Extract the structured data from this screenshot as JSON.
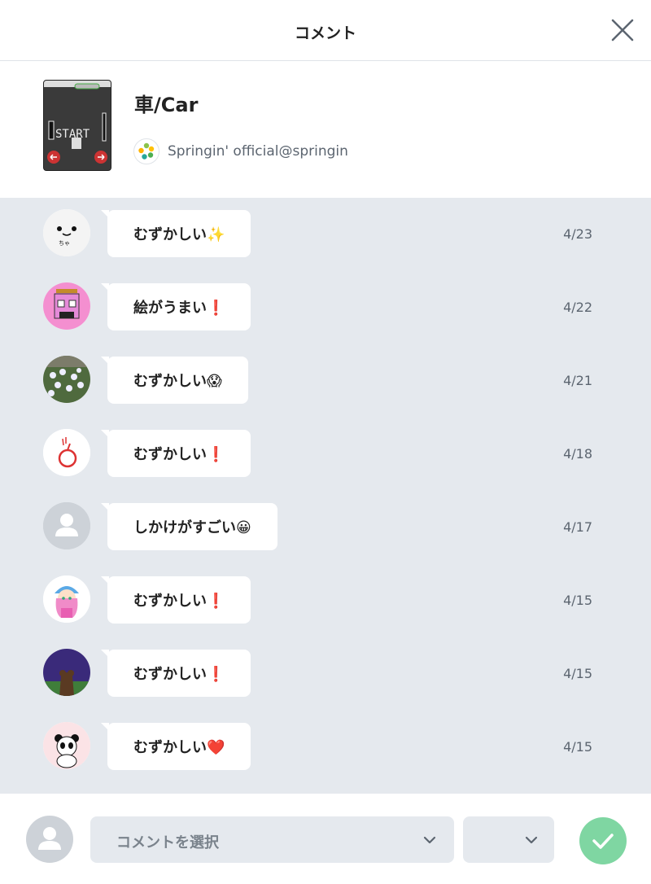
{
  "header": {
    "title": "コメント"
  },
  "work": {
    "title": "車/Car",
    "author": "Springin' official@springin",
    "thumb_text": "START"
  },
  "comments": [
    {
      "text": "むずかしい✨",
      "date": "4/23",
      "avatar": "face-white"
    },
    {
      "text": "絵がうまい❗",
      "date": "4/22",
      "avatar": "pink-robot"
    },
    {
      "text": "むずかしい😱",
      "date": "4/21",
      "avatar": "flowers-photo"
    },
    {
      "text": "むずかしい❗",
      "date": "4/18",
      "avatar": "red-apple"
    },
    {
      "text": "しかけがすごい😀",
      "date": "4/17",
      "avatar": "default-user"
    },
    {
      "text": "むずかしい❗",
      "date": "4/15",
      "avatar": "girl-blue-hat"
    },
    {
      "text": "むずかしい❗",
      "date": "4/15",
      "avatar": "night-scene"
    },
    {
      "text": "むずかしい❤️",
      "date": "4/15",
      "avatar": "panda"
    }
  ],
  "footer": {
    "select_placeholder": "コメントを選択"
  },
  "colors": {
    "list_bg": "#e5e9ee",
    "send": "#7fd6a2"
  }
}
